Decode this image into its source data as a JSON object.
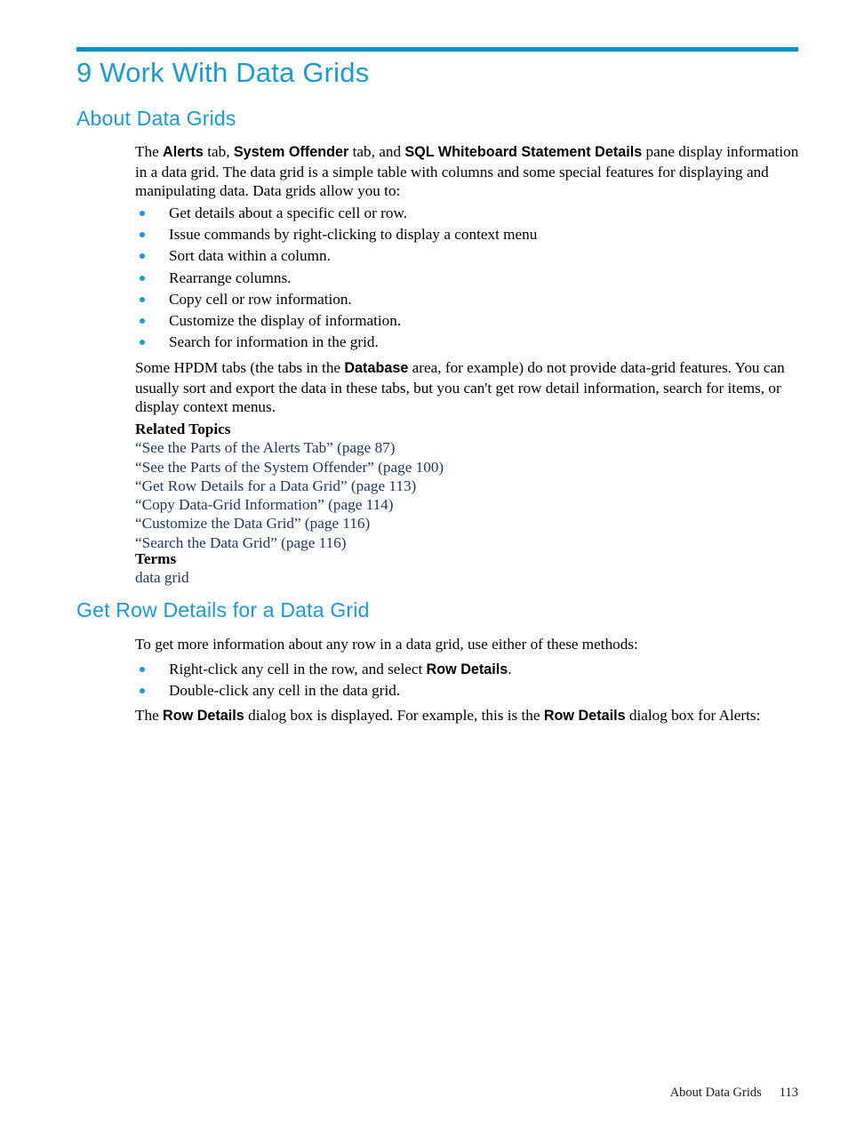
{
  "document": {
    "chapter_heading": "9 Work With Data Grids",
    "accent_color": "#1B9AD3",
    "rule_color": "#0091CE",
    "link_color": "#1F3864"
  },
  "about_section": {
    "heading": "About Data Grids",
    "intro_paragraph": {
      "part1": "The ",
      "term1": "Alerts",
      "part2": " tab, ",
      "term2": "System Offender",
      "part3": " tab, and ",
      "term3": "SQL Whiteboard Statement Details",
      "part4": " pane display information in a data grid. The data grid is a simple table with columns and some special features for displaying and manipulating data. Data grids allow you to:"
    },
    "bullets": [
      "Get details about a specific cell or row.",
      "Issue commands by right-clicking to display a context menu",
      "Sort data within a column.",
      "Rearrange columns.",
      "Copy cell or row information.",
      "Customize the display of information.",
      "Search for information in the grid."
    ],
    "hpdm_paragraph": {
      "part1": "Some HPDM tabs (the tabs in the ",
      "term1": "Database",
      "part2": " area, for example) do not provide data-grid features. You can usually sort and export the data in these tabs, but you can't get row detail information, search for items, or display context menus."
    },
    "related_topics": {
      "heading": "Related Topics",
      "links": [
        "“See the Parts of the Alerts Tab” (page 87)",
        "“See the Parts of the System Offender” (page 100)",
        "“Get Row Details for a Data Grid” (page 113)",
        "“Copy Data-Grid Information” (page 114)",
        "“Customize the Data Grid” (page 116)",
        "“Search the Data Grid” (page 116)"
      ]
    },
    "terms": {
      "heading": "Terms",
      "items": [
        "data grid"
      ]
    }
  },
  "getrow_section": {
    "heading": "Get Row Details for a Data Grid",
    "intro": "To get more information about any row in a data grid, use either of these methods:",
    "bullets": [
      {
        "part1": "Right-click any cell in the row, and select ",
        "term1": "Row Details",
        "part2": "."
      },
      {
        "part1": "Double-click any cell in the data grid.",
        "term1": "",
        "part2": ""
      }
    ],
    "closing_paragraph": {
      "part1": "The ",
      "term1": "Row Details",
      "part2": " dialog box is displayed. For example, this is the ",
      "term2": "Row Details",
      "part3": " dialog box for Alerts:"
    }
  },
  "footer": {
    "section_title": "About Data Grids",
    "page_number": "113"
  }
}
